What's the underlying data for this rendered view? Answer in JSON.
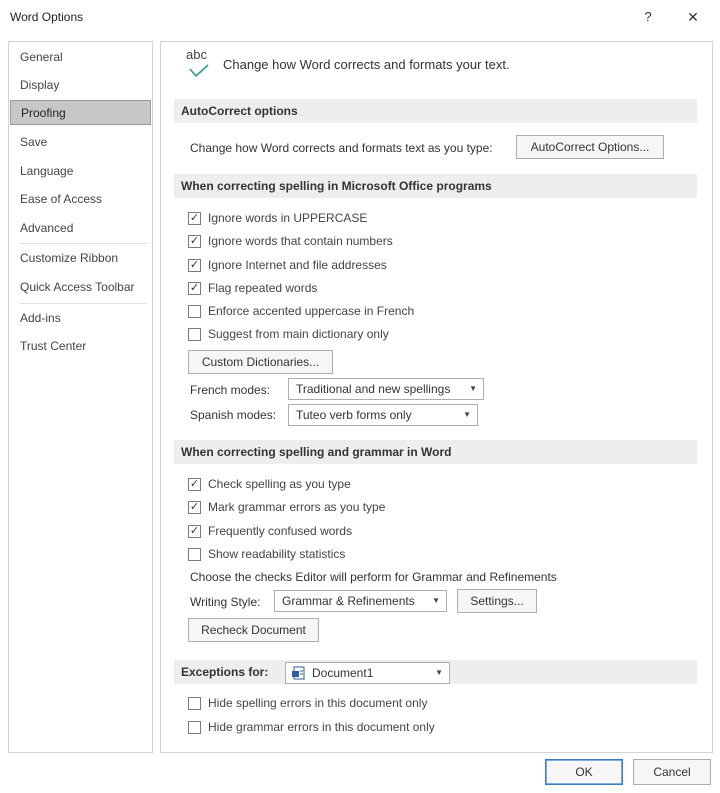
{
  "window": {
    "title": "Word Options",
    "help": "?",
    "close": "✕"
  },
  "sidebar": {
    "items": [
      {
        "label": "General"
      },
      {
        "label": "Display"
      },
      {
        "label": "Proofing"
      },
      {
        "label": "Save"
      },
      {
        "label": "Language"
      },
      {
        "label": "Ease of Access"
      },
      {
        "label": "Advanced"
      },
      {
        "label": "Customize Ribbon"
      },
      {
        "label": "Quick Access Toolbar"
      },
      {
        "label": "Add-ins"
      },
      {
        "label": "Trust Center"
      }
    ],
    "selected": "Proofing"
  },
  "header": {
    "icon_text": "abc",
    "text": "Change how Word corrects and formats your text."
  },
  "autocorrect": {
    "heading": "AutoCorrect options",
    "description": "Change how Word corrects and formats text as you type:",
    "button": "AutoCorrect Options..."
  },
  "office_spelling": {
    "heading": "When correcting spelling in Microsoft Office programs",
    "checkboxes": [
      {
        "label": "Ignore words in UPPERCASE",
        "checked": true
      },
      {
        "label": "Ignore words that contain numbers",
        "checked": true
      },
      {
        "label": "Ignore Internet and file addresses",
        "checked": true
      },
      {
        "label": "Flag repeated words",
        "checked": true
      },
      {
        "label": "Enforce accented uppercase in French",
        "checked": false
      },
      {
        "label": "Suggest from main dictionary only",
        "checked": false
      }
    ],
    "custom_dictionaries_button": "Custom Dictionaries...",
    "french_modes_label": "French modes:",
    "french_modes_value": "Traditional and new spellings",
    "spanish_modes_label": "Spanish modes:",
    "spanish_modes_value": "Tuteo verb forms only"
  },
  "word_spelling": {
    "heading": "When correcting spelling and grammar in Word",
    "checkboxes": [
      {
        "label": "Check spelling as you type",
        "checked": true
      },
      {
        "label": "Mark grammar errors as you type",
        "checked": true
      },
      {
        "label": "Frequently confused words",
        "checked": true
      },
      {
        "label": "Show readability statistics",
        "checked": false
      }
    ],
    "editor_text": "Choose the checks Editor will perform for Grammar and Refinements",
    "writing_style_label": "Writing Style:",
    "writing_style_value": "Grammar & Refinements",
    "settings_button": "Settings...",
    "recheck_button": "Recheck Document"
  },
  "exceptions": {
    "label": "Exceptions for:",
    "document": "Document1",
    "checkboxes": [
      {
        "label": "Hide spelling errors in this document only",
        "checked": false
      },
      {
        "label": "Hide grammar errors in this document only",
        "checked": false
      }
    ]
  },
  "footer": {
    "ok": "OK",
    "cancel": "Cancel"
  },
  "colors": {
    "selected_nav": "#c7c7c7",
    "section_bg": "#eeeeee",
    "abc_check": "#2b9c8f",
    "ok_border": "#3d7bbf",
    "doc_icon": "#2e5c9e"
  }
}
